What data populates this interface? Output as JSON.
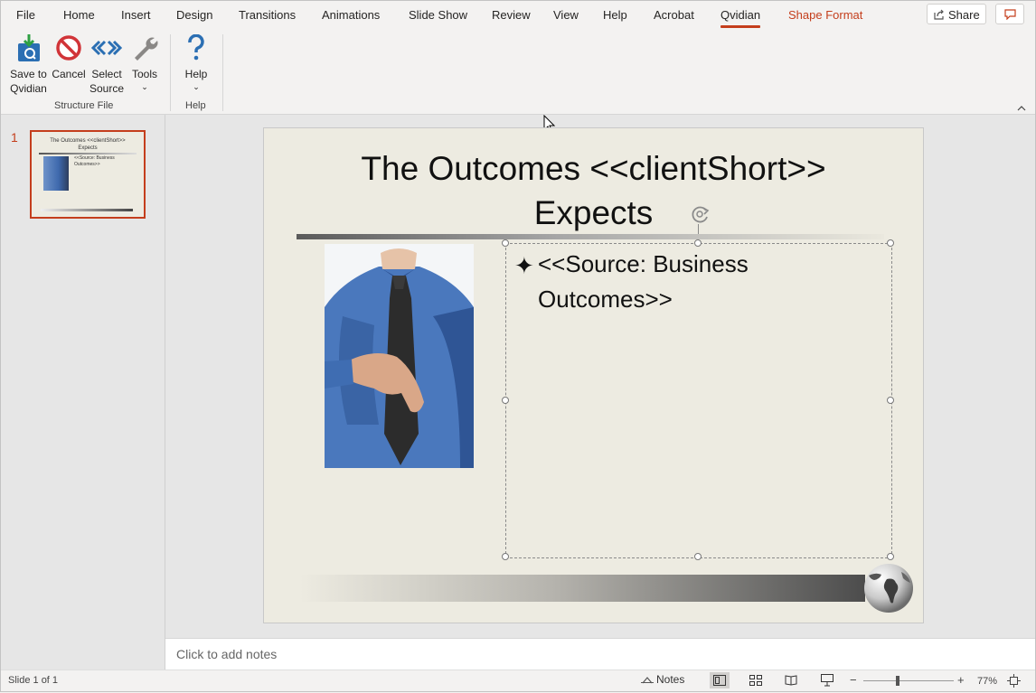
{
  "tabs": [
    "File",
    "Home",
    "Insert",
    "Design",
    "Transitions",
    "Animations",
    "Slide Show",
    "Review",
    "View",
    "Help",
    "Acrobat",
    "Qvidian",
    "Shape Format"
  ],
  "share_label": "Share",
  "ribbon": {
    "buttons": {
      "save": "Save to\nQvidian",
      "cancel": "Cancel",
      "select": "Select\nSource",
      "tools": "Tools",
      "help": "Help"
    },
    "groups": {
      "structure": "Structure File",
      "help": "Help"
    }
  },
  "thumbnail": {
    "number": "1",
    "title": "The Outcomes <<clientShort>>\nExpects",
    "text": "<<Source: Business\nOutcomes>>"
  },
  "slide": {
    "title": "The Outcomes <<clientShort>>\nExpects",
    "bullet": "✦",
    "content": "<<Source: Business\nOutcomes>>"
  },
  "notes_placeholder": "Click to add notes",
  "status": {
    "slide_count": "Slide 1 of 1",
    "notes": "Notes",
    "zoom": "77%"
  },
  "colors": {
    "accent": "#c43e1c",
    "ribbon_bg": "#f3f2f1",
    "slide_bg": "#edebe1"
  }
}
